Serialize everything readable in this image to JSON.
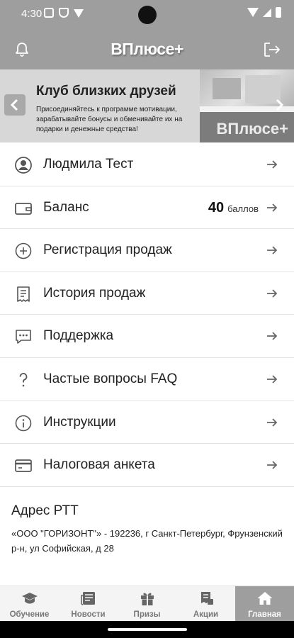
{
  "status_bar": {
    "time": "4:30"
  },
  "header": {
    "logo": "ВПлюсе+"
  },
  "banner": {
    "title": "Клуб близких друзей",
    "description": "Присоединяйтесь к программе мотивации, зарабатывайте бонусы и обменивайте их на подарки и денежные средства!",
    "watermark": "ВПлюсе+"
  },
  "menu": {
    "items": [
      {
        "label": "Людмила Тест",
        "icon": "user-circle-icon"
      },
      {
        "label": "Баланс",
        "icon": "wallet-icon",
        "points": "40",
        "points_unit": "баллов"
      },
      {
        "label": "Регистрация продаж",
        "icon": "plus-circle-icon"
      },
      {
        "label": "История продаж",
        "icon": "receipt-icon"
      },
      {
        "label": "Поддержка",
        "icon": "chat-icon"
      },
      {
        "label": "Частые вопросы FAQ",
        "icon": "question-icon"
      },
      {
        "label": "Инструкции",
        "icon": "info-icon"
      },
      {
        "label": "Налоговая анкета",
        "icon": "credit-card-icon"
      }
    ]
  },
  "address": {
    "heading": "Адрес РТТ",
    "text": "«ООО \"ГОРИЗОНТ\"» - 192236, г Санкт-Петербург, Фрунзенский р-н, ул Софийская, д 28"
  },
  "bottom_nav": {
    "tabs": [
      {
        "label": "Обучение",
        "icon": "graduation-cap-icon"
      },
      {
        "label": "Новости",
        "icon": "newspaper-icon"
      },
      {
        "label": "Призы",
        "icon": "gift-icon"
      },
      {
        "label": "Акции",
        "icon": "promo-icon"
      },
      {
        "label": "Главная",
        "icon": "home-icon",
        "active": true
      }
    ]
  },
  "colors": {
    "header_bg": "#9e9e9e",
    "active_tab_bg": "#9e9e9e",
    "text": "#222222"
  }
}
